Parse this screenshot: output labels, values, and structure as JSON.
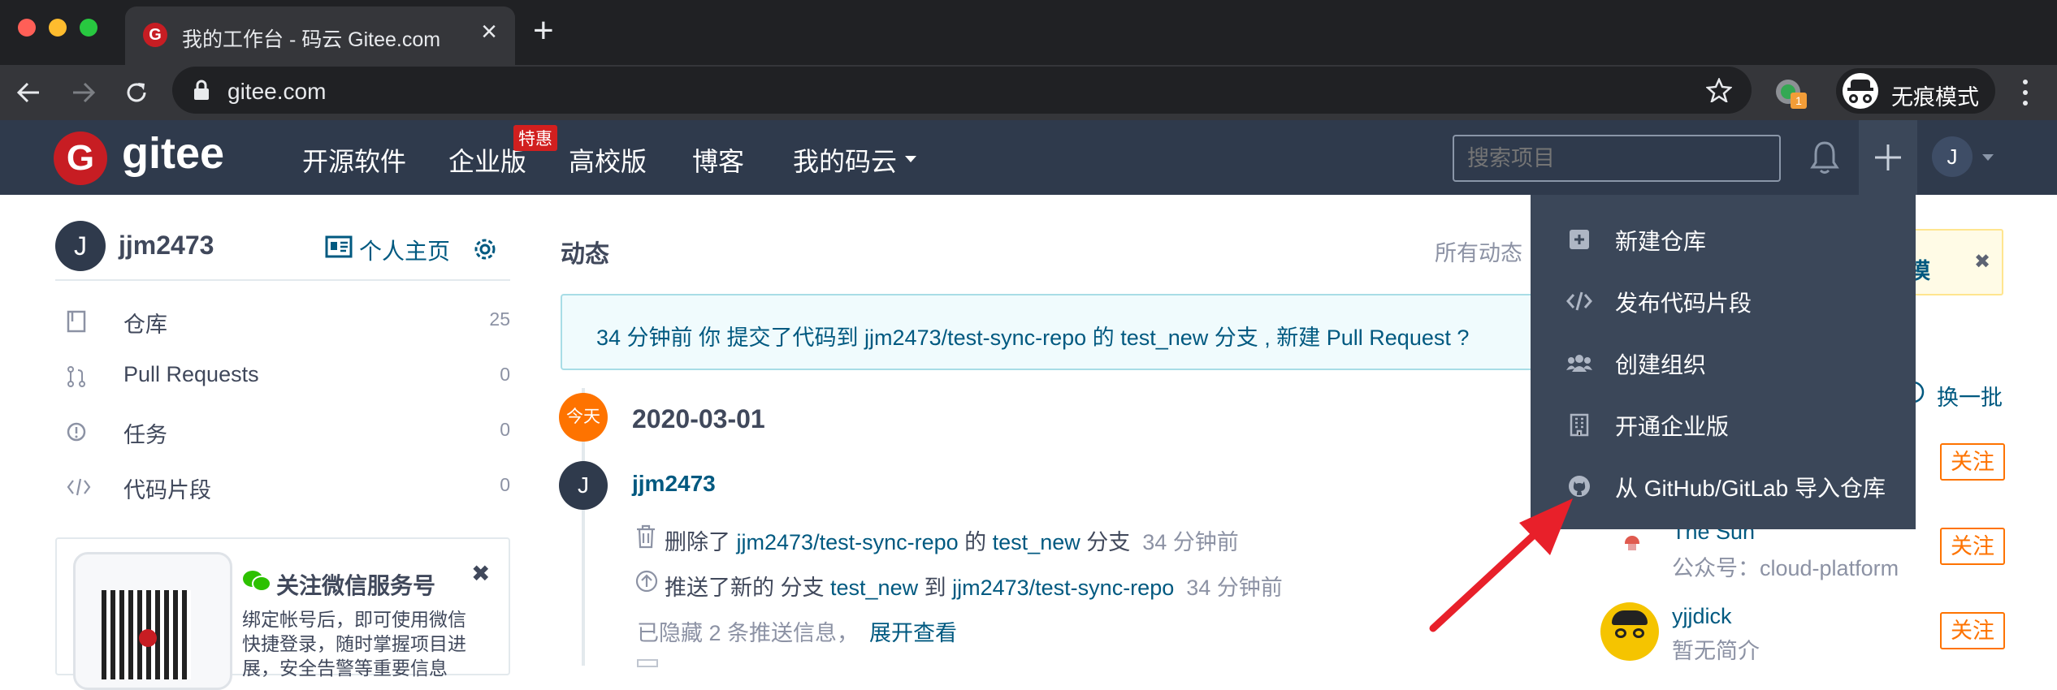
{
  "browser": {
    "tab_title": "我的工作台 - 码云 Gitee.com",
    "tab_close": "×",
    "new_tab": "+",
    "url": "gitee.com",
    "incognito_label": "无痕模式",
    "extension_badge": "1"
  },
  "header": {
    "logo_text": "gitee",
    "nav": [
      "开源软件",
      "企业版",
      "高校版",
      "博客",
      "我的码云"
    ],
    "enterprise_badge": "特惠",
    "search_placeholder": "搜索项目",
    "avatar_letter": "J"
  },
  "sidebar": {
    "user_letter": "J",
    "username": "jjm2473",
    "homepage_link": "个人主页",
    "items": [
      {
        "label": "仓库",
        "count": "25",
        "icon": "repo-icon"
      },
      {
        "label": "Pull Requests",
        "count": "0",
        "icon": "pull-request-icon"
      },
      {
        "label": "任务",
        "count": "0",
        "icon": "issue-icon"
      },
      {
        "label": "代码片段",
        "count": "0",
        "icon": "code-snippet-icon"
      }
    ],
    "wechat": {
      "title": "关注微信服务号",
      "desc_line1": "绑定帐号后，即可使用微信",
      "desc_line2": "快捷登录，随时掌握项目进",
      "desc_line3": "展，安全告警等重要信息",
      "close": "✖"
    }
  },
  "feed": {
    "title": "动态",
    "filter": "所有动态",
    "notice_prefix": "34 分钟前 你 提交了代码到 ",
    "notice_repo": "jjm2473/test-sync-repo",
    "notice_mid": " 的 ",
    "notice_branch": "test_new",
    "notice_suffix": " 分支 , 新建 Pull Request ?",
    "today_badge": "今天",
    "date": "2020-03-01",
    "event_user_letter": "J",
    "event_user": "jjm2473",
    "events": [
      {
        "pre": "删除了 ",
        "repo": "jjm2473/test-sync-repo",
        "mid": " 的 ",
        "branch": "test_new",
        "post": " 分支",
        "time": "34 分钟前"
      },
      {
        "pre": "推送了新的 分支 ",
        "branch": "test_new",
        "mid": " 到 ",
        "repo": "jjm2473/test-sync-repo",
        "time": "34 分钟前"
      }
    ],
    "hidden_text": "已隐藏 2 条推送信息，",
    "expand_link": "展开查看"
  },
  "dropdown": {
    "items": [
      {
        "label": "新建仓库",
        "icon": "plus-square-icon"
      },
      {
        "label": "发布代码片段",
        "icon": "code-icon"
      },
      {
        "label": "创建组织",
        "icon": "group-icon"
      },
      {
        "label": "开通企业版",
        "icon": "building-icon"
      },
      {
        "label": "从 GitHub/GitLab 导入仓库",
        "icon": "github-icon"
      }
    ]
  },
  "right_panel": {
    "banner_fragment": "能模",
    "banner_close": "✖",
    "refresh": "换一批",
    "follow_label": "关注",
    "users": [
      {
        "name": "The Sun",
        "desc": "公众号：cloud-platform"
      },
      {
        "name": "yjjdick",
        "desc": "暂无简介"
      }
    ]
  },
  "colors": {
    "header_bg": "#2f3a4c",
    "dropdown_bg": "#3b4759",
    "link": "#005980",
    "accent_orange": "#fe7300",
    "gitee_red": "#c71d23",
    "arrow_red": "#e8202a"
  }
}
